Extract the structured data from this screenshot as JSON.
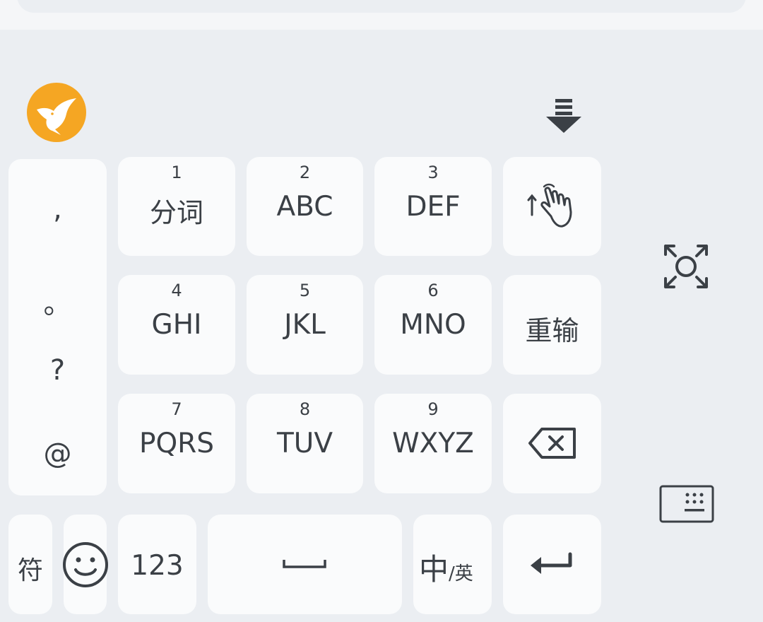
{
  "toolbar": {
    "logo_icon": "hummingbird-logo-icon",
    "collapse_icon": "collapse-keyboard-icon"
  },
  "symbols": [
    ",",
    "。",
    "?",
    "@"
  ],
  "keys": [
    {
      "num": "1",
      "label": "分词"
    },
    {
      "num": "2",
      "label": "ABC"
    },
    {
      "num": "3",
      "label": "DEF"
    },
    {
      "num": "4",
      "label": "GHI"
    },
    {
      "num": "5",
      "label": "JKL"
    },
    {
      "num": "6",
      "label": "MNO"
    },
    {
      "num": "7",
      "label": "PQRS"
    },
    {
      "num": "8",
      "label": "TUV"
    },
    {
      "num": "9",
      "label": "WXYZ"
    }
  ],
  "side_keys": {
    "gesture_icon": "hand-gesture-icon",
    "reinput_label": "重输",
    "backspace_icon": "backspace-icon"
  },
  "bottom_row": {
    "symbol_label": "符",
    "emoji_icon": "emoji-icon",
    "numbers_label": "123",
    "space_icon": "space-bar-icon",
    "lang_main": "中",
    "lang_alt": "/英",
    "enter_icon": "enter-icon"
  },
  "right_side": {
    "scan_icon": "scan-expand-icon",
    "keyboard_icon": "keyboard-switch-icon"
  },
  "colors": {
    "background": "#ebeef2",
    "key": "#fafbfc",
    "text": "#3b4046",
    "logo": "#f5a623"
  }
}
